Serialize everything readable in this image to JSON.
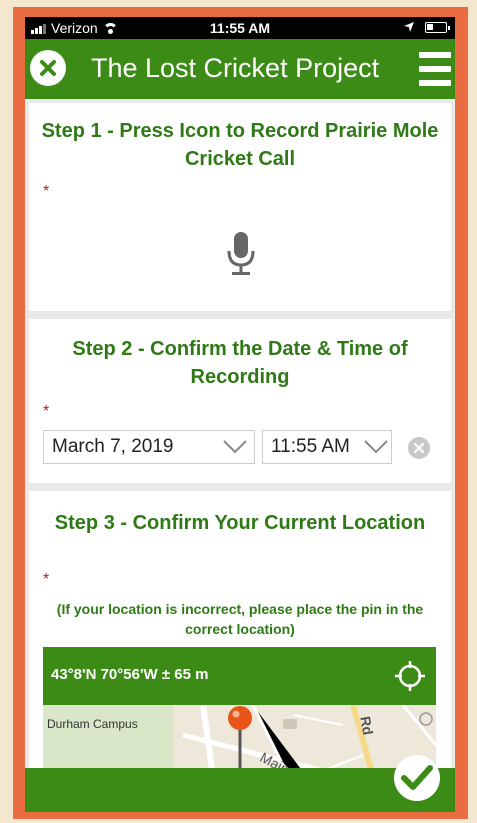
{
  "status_bar": {
    "carrier": "Verizon",
    "time": "11:55 AM"
  },
  "header": {
    "title": "The Lost Cricket Project",
    "close_icon": "close-circle-icon",
    "menu_icon": "hamburger-menu-icon"
  },
  "step1": {
    "title": "Step 1 - Press Icon to Record Prairie Mole Cricket Call",
    "required_mark": "*",
    "icon": "microphone-icon"
  },
  "step2": {
    "title": "Step 2 - Confirm the Date & Time of Recording",
    "required_mark": "*",
    "date_value": "March 7, 2019",
    "time_value": "11:55 AM"
  },
  "step3": {
    "title": "Step 3 - Confirm Your Current Location",
    "required_mark": "*",
    "hint": "(If your location is incorrect, please place the pin in the correct location)",
    "coordinates": "43°8'N 70°56'W ± 65 m",
    "map_labels": {
      "campus": "Durham Campus",
      "street": "Main St",
      "road": "Rd"
    }
  },
  "colors": {
    "brand_green": "#3d8b17",
    "frame_orange": "#ea6d42",
    "required_red": "#b3201f",
    "pin_orange": "#e8541a"
  }
}
